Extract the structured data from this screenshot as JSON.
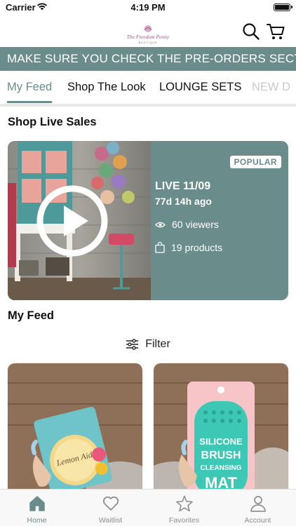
{
  "status_bar": {
    "carrier": "Carrier",
    "time": "4:19 PM"
  },
  "header": {
    "logo": {
      "text": "The Freedom Penny",
      "subtext": "BOUTIQUE"
    }
  },
  "banner": {
    "text": "MAKE SURE YOU CHECK THE PRE-ORDERS SECTION!"
  },
  "tabs": [
    {
      "label": "My Feed",
      "active": true
    },
    {
      "label": "Shop The Look",
      "active": false
    },
    {
      "label": "LOUNGE SETS",
      "active": false
    },
    {
      "label": "NEW D",
      "active": false
    }
  ],
  "live_sales": {
    "section_title": "Shop Live Sales",
    "card": {
      "badge": "POPULAR",
      "title": "LIVE 11/09",
      "time_ago": "77d 14h ago",
      "viewers": "60 viewers",
      "products": "19 products"
    }
  },
  "feed": {
    "section_title": "My Feed",
    "filter_label": "Filter"
  },
  "products": [
    {
      "name": "Lemon Aid cleansing product",
      "brand_text": "Lemon Aid"
    },
    {
      "name": "Silicone Brush Cleansing Mat",
      "brand_text": "SILICONE BRUSH CLEANSING MAT"
    }
  ],
  "bottom_nav": [
    {
      "label": "Home",
      "icon": "home-icon",
      "active": true
    },
    {
      "label": "Waitlist",
      "icon": "heart-icon",
      "active": false
    },
    {
      "label": "Favorites",
      "icon": "star-icon",
      "active": false
    },
    {
      "label": "Account",
      "icon": "person-icon",
      "active": false
    }
  ],
  "colors": {
    "accent": "#6a8c8a",
    "banner_bg": "#6a8c8a",
    "badge_text": "#6a8c8a",
    "inactive": "#8e8e8e"
  }
}
